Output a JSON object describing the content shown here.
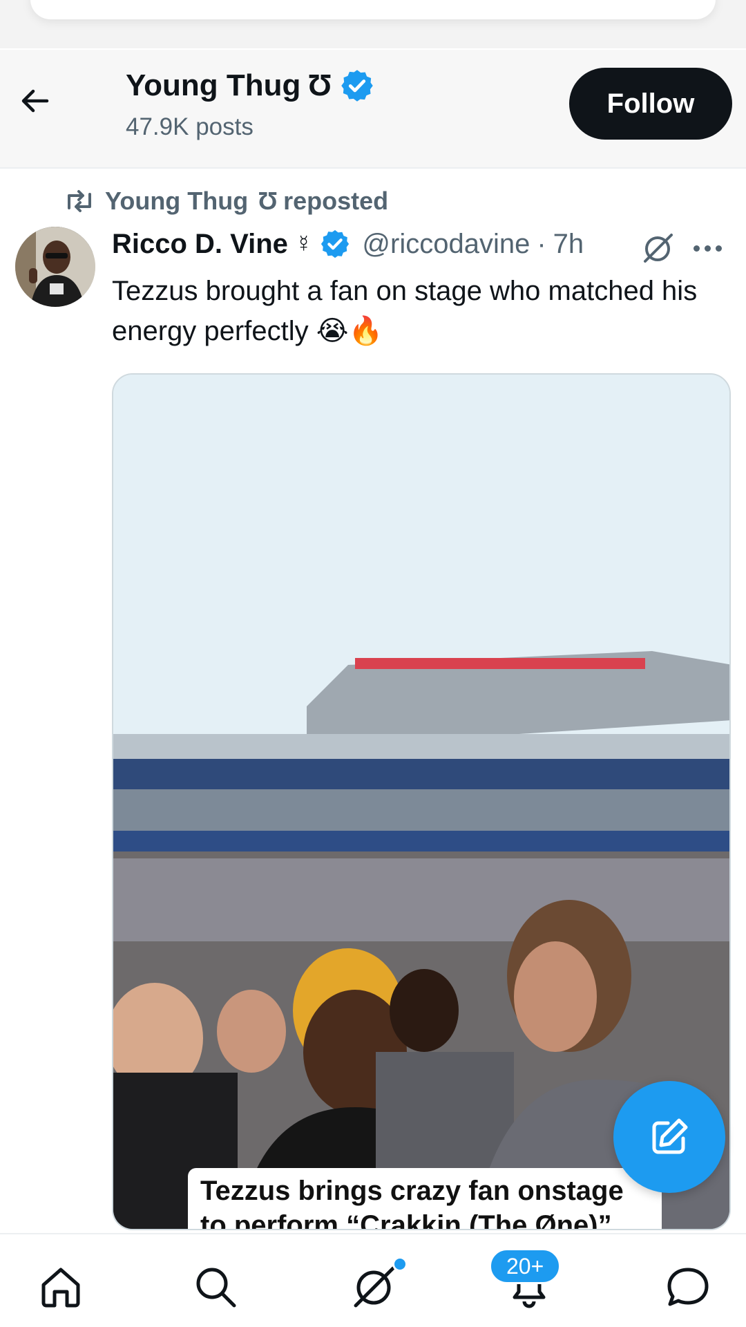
{
  "header": {
    "name": "Young Thug",
    "name_symbol": "Ʊ",
    "posts": "47.9K posts",
    "follow_label": "Follow"
  },
  "repost": {
    "by": "Young Thug",
    "by_symbol": "Ʊ",
    "suffix": "reposted"
  },
  "tweet": {
    "author": "Ricco D. Vine",
    "author_symbol": "☿",
    "handle": "@riccodavine",
    "separator": "·",
    "time": "7h",
    "text": "Tezzus brought a fan on stage who matched his energy perfectly 😭🔥",
    "media_caption": "Tezzus brings crazy fan onstage to perform “Crakkin (The Øne)”"
  },
  "nav": {
    "notifications_badge": "20+"
  },
  "colors": {
    "accent": "#1d9bf0",
    "text_primary": "#0f1419",
    "text_secondary": "#536471",
    "follow_bg": "#0f1419"
  },
  "icons": [
    "back-arrow-icon",
    "verified-icon",
    "repost-icon",
    "grok-icon",
    "more-icon",
    "compose-icon",
    "home-icon",
    "search-icon",
    "bell-icon",
    "chat-icon"
  ]
}
